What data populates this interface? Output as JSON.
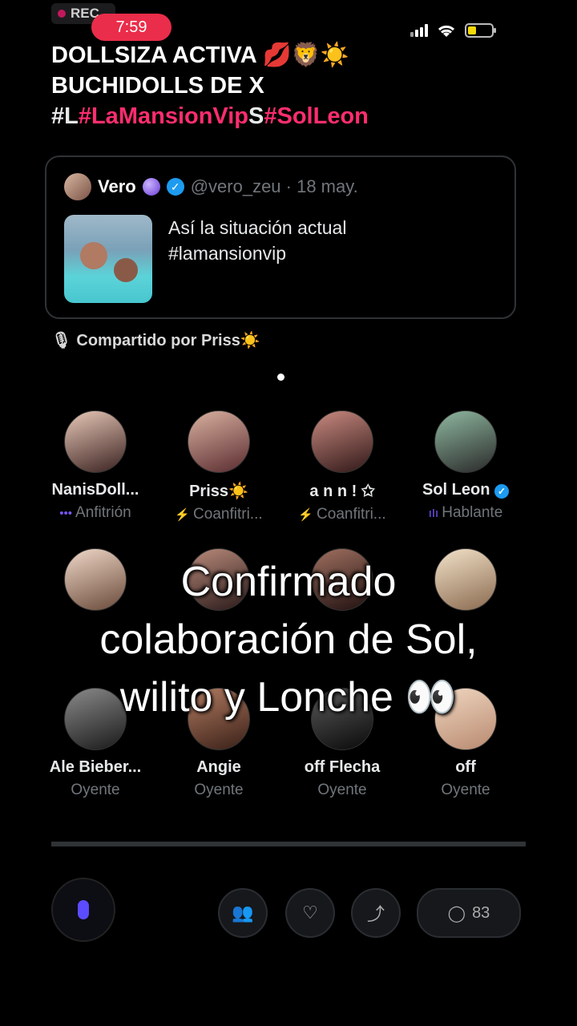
{
  "status_bar": {
    "rec": "REC",
    "time": "7:59"
  },
  "title": {
    "line1": "DOLLSIZA ACTIVA 💋🦁☀️",
    "line2": "BUCHIDOLLS DE X",
    "line3_prefix": "#L",
    "line3_tag1": "#LaMansionVip",
    "line3_mid": "S",
    "line3_tag2": "#SolLeon"
  },
  "tweet": {
    "author": "Vero",
    "handle": "@vero_zeu · 18 may.",
    "text_line1": "Así la situación actual",
    "text_line2": "#lamansionvip"
  },
  "shared_by": "Compartido por Priss☀️",
  "participants": [
    {
      "name": "NanisDoll...",
      "role": "Anfitrión",
      "role_icon": "•••"
    },
    {
      "name": "Priss☀️",
      "role": "Coanfitri...",
      "role_icon": "⚡"
    },
    {
      "name": "a n n ! ✩",
      "role": "Coanfitri...",
      "role_icon": "⚡"
    },
    {
      "name": "Sol Leon",
      "role": "Hablante",
      "role_icon": "ıIı"
    },
    {
      "name": "Ale Bieber...",
      "role": "Oyente"
    },
    {
      "name": "Angie",
      "role": "Oyente"
    },
    {
      "name": "off Flecha",
      "role": "Oyente"
    },
    {
      "name": "off",
      "role": "Oyente"
    }
  ],
  "caption": {
    "line1": "Confirmado",
    "line2": "colaboración de Sol,",
    "line3": "wilito y Lonche 👀"
  },
  "bottom": {
    "listener_count": "83"
  },
  "colors": {
    "accent_pink": "#ff2d6f",
    "time_pill": "#ea2d4a",
    "verified": "#1d9bf0"
  }
}
